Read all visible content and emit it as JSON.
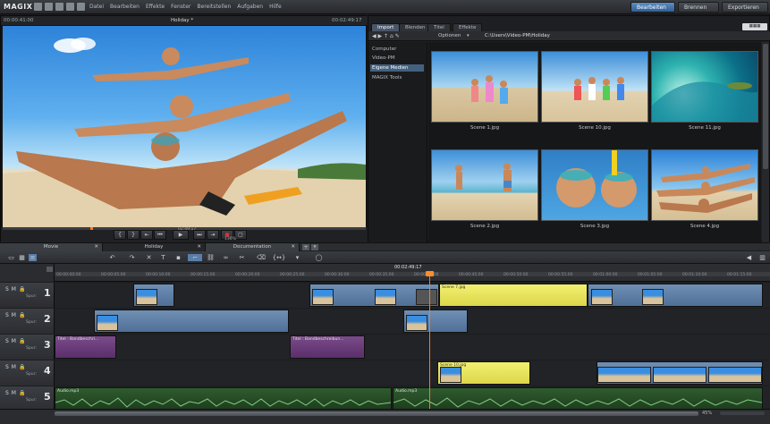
{
  "app": {
    "name": "MAGIX"
  },
  "menu": {
    "items": [
      "Datei",
      "Bearbeiten",
      "Effekte",
      "Fenster",
      "Bereitstellen",
      "Aufgaben",
      "Hilfe"
    ]
  },
  "modes": {
    "edit": "Bearbeiten",
    "burn": "Brennen",
    "export": "Exportieren"
  },
  "preview": {
    "time_left": "00:00:41:00",
    "title": "Holiday *",
    "time_right": "00:02:49:17",
    "transport_time": "02:49:17",
    "zoom": "130%"
  },
  "pool": {
    "tabs": [
      "Import",
      "Blenden",
      "Titel",
      "Effekte"
    ],
    "options_label": "Optionen",
    "path": "C:\\Users\\Video-PM\\Holiday",
    "tree": [
      "Computer",
      "Video-PM",
      "Eigene Medien",
      "MAGIX Tools"
    ],
    "tree_selected": 2,
    "thumbs": [
      {
        "caption": "Scene 1.jpg"
      },
      {
        "caption": "Scene 10.jpg"
      },
      {
        "caption": "Scene 11.jpg"
      },
      {
        "caption": "Scene 2.jpg"
      },
      {
        "caption": "Scene 3.jpg"
      },
      {
        "caption": "Scene 4.jpg"
      }
    ]
  },
  "projects": {
    "tabs": [
      "Movie",
      "Holiday",
      "Documentation"
    ]
  },
  "ruler": {
    "position": "00:02:49:17",
    "ticks": [
      "00:00:00:00",
      "00:00:05:00",
      "00:00:10:00",
      "00:00:15:00",
      "00:00:20:00",
      "00:00:25:00",
      "00:00:30:00",
      "00:00:35:00",
      "00:00:40:00",
      "00:00:45:00",
      "00:00:50:00",
      "00:00:55:00",
      "00:01:00:00",
      "00:01:05:00",
      "00:01:10:00",
      "00:01:15:00"
    ]
  },
  "tracks": [
    {
      "num": "1",
      "spur": "Spur:",
      "clips": [
        {
          "label": ""
        },
        {
          "label": ""
        },
        {
          "label": "Scene 7.jpg"
        },
        {
          "label": ""
        }
      ]
    },
    {
      "num": "2",
      "spur": "Spur:",
      "clips": [
        {
          "label": ""
        },
        {
          "label": ""
        }
      ]
    },
    {
      "num": "3",
      "spur": "Spur:",
      "clips": [
        {
          "label": "Titel : Bandbeschri..."
        },
        {
          "label": "Titel : Bandbeschreibun..."
        }
      ]
    },
    {
      "num": "4",
      "spur": "Spur:",
      "clips": [
        {
          "label": "Scene 10.jpg"
        },
        {
          "label": ""
        }
      ]
    },
    {
      "num": "5",
      "spur": "Spur:",
      "clips": [
        {
          "label": "Audio.mp3"
        },
        {
          "label": "Audio.mp3"
        }
      ]
    }
  ],
  "status": {
    "zoom": "45%"
  }
}
